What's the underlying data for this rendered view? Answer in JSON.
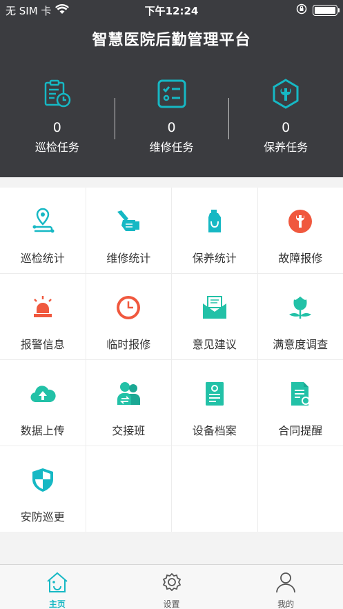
{
  "status_bar": {
    "carrier": "无 SIM 卡",
    "time": "下午12:24"
  },
  "header": {
    "title": "智慧医院后勤管理平台"
  },
  "stats": [
    {
      "value": "0",
      "label": "巡检任务",
      "icon": "clipboard-clock-icon"
    },
    {
      "value": "0",
      "label": "维修任务",
      "icon": "checklist-icon"
    },
    {
      "value": "0",
      "label": "保养任务",
      "icon": "wrench-hexagon-icon"
    }
  ],
  "grid": [
    {
      "label": "巡检统计",
      "icon": "location-route-icon"
    },
    {
      "label": "维修统计",
      "icon": "hand-wrench-icon"
    },
    {
      "label": "保养统计",
      "icon": "oil-bottle-icon"
    },
    {
      "label": "故障报修",
      "icon": "wrench-circle-icon"
    },
    {
      "label": "报警信息",
      "icon": "alarm-siren-icon"
    },
    {
      "label": "临时报修",
      "icon": "clock-icon"
    },
    {
      "label": "意见建议",
      "icon": "envelope-icon"
    },
    {
      "label": "满意度调查",
      "icon": "flower-icon"
    },
    {
      "label": "数据上传",
      "icon": "cloud-upload-icon"
    },
    {
      "label": "交接班",
      "icon": "users-swap-icon"
    },
    {
      "label": "设备档案",
      "icon": "device-file-icon"
    },
    {
      "label": "合同提醒",
      "icon": "contract-icon"
    },
    {
      "label": "安防巡更",
      "icon": "shield-icon"
    }
  ],
  "tabs": [
    {
      "label": "主页",
      "icon": "home-icon",
      "active": true
    },
    {
      "label": "设置",
      "icon": "gear-icon",
      "active": false
    },
    {
      "label": "我的",
      "icon": "person-icon",
      "active": false
    }
  ],
  "colors": {
    "header_bg": "#3b3c40",
    "teal": "#16b8c4",
    "red": "#f0583e"
  }
}
